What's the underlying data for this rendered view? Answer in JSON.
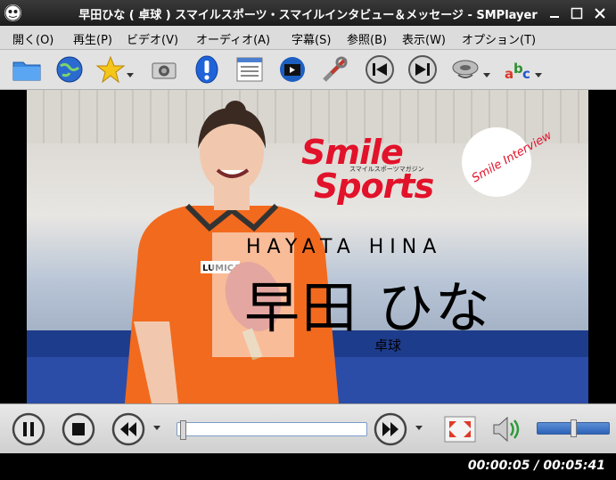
{
  "window": {
    "title": "早田ひな ( 卓球 ) スマイルスポーツ・スマイルインタビュー＆メッセージ - SMPlayer"
  },
  "menubar": {
    "items": [
      {
        "label": "開く(O)"
      },
      {
        "label": "再生(P)"
      },
      {
        "label": "ビデオ(V)"
      },
      {
        "label": "オーディオ(A)"
      },
      {
        "label": "字幕(S)"
      },
      {
        "label": "参照(B)"
      },
      {
        "label": "表示(W)"
      },
      {
        "label": "オプション(T)"
      }
    ]
  },
  "toolbar": {
    "icons": [
      "folder-icon",
      "globe-icon",
      "star-icon",
      "screenshot-camera-icon",
      "info-icon",
      "playlist-icon",
      "video-clapper-icon",
      "tools-icon",
      "previous-track-icon",
      "next-track-icon",
      "audio-disc-icon",
      "subtitles-abc-icon"
    ]
  },
  "video": {
    "logo_line1": "Smile",
    "logo_line2": "Sports",
    "logo_sub": "スマイルスポーツマガジン",
    "badge_text": "Smile Interview",
    "name_en": "HAYATA  HINA",
    "name_jp": "早田 ひな",
    "sport": "卓球",
    "shirt_text": "LUMICA"
  },
  "controls": {
    "seek_fraction": 0.015,
    "volume_fraction": 0.5
  },
  "status": {
    "time": "00:00:05 / 00:05:41"
  },
  "colors": {
    "brand_red": "#e2122a",
    "shirt_orange": "#f26a1e",
    "court_blue": "#1e3c8c"
  }
}
